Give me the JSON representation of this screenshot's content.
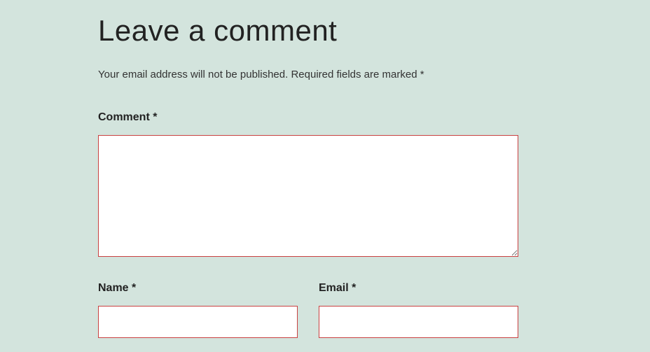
{
  "heading": "Leave a comment",
  "notice": {
    "line1": "Your email address will not be published.",
    "line2": "Required fields are marked *"
  },
  "fields": {
    "comment": {
      "label": "Comment *",
      "value": ""
    },
    "name": {
      "label": "Name *",
      "value": ""
    },
    "email": {
      "label": "Email *",
      "value": ""
    }
  }
}
